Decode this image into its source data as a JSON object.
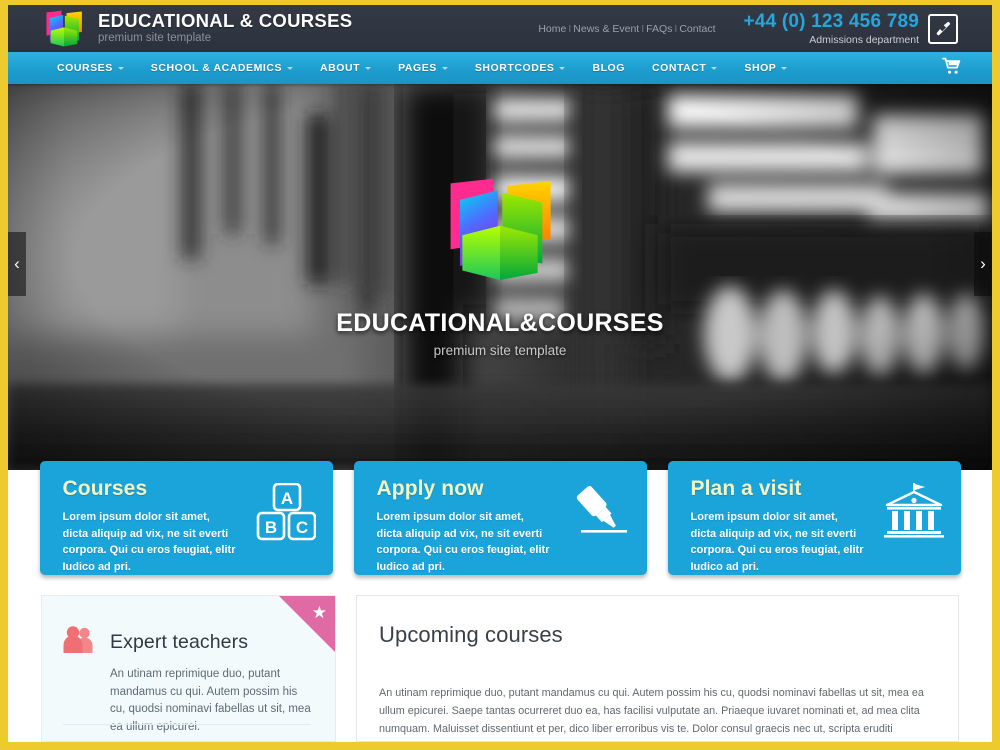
{
  "theme": {
    "frame_color": "#edcb2e",
    "accent_blue": "#1ba4da",
    "dark_bar": "#2e3440",
    "promo_heading": "#f2f5c3",
    "ribbon_pink": "#e06ba4",
    "teacher_icon": "#f0757a"
  },
  "header": {
    "brand_title": "EDUCATIONAL & COURSES",
    "brand_subtitle": "premium site template",
    "logo_icon": "open-book-logo-icon",
    "top_links": [
      "Home",
      "News & Event",
      "FAQs",
      "Contact"
    ],
    "separator": "I",
    "phone_number": "+44 (0) 123 456 789",
    "phone_label": "Admissions department",
    "phone_icon": "phone-handset-icon"
  },
  "nav": {
    "items": [
      {
        "label": "COURSES",
        "has_caret": true
      },
      {
        "label": "SCHOOL & ACADEMICS",
        "has_caret": true
      },
      {
        "label": "ABOUT",
        "has_caret": true
      },
      {
        "label": "PAGES",
        "has_caret": true
      },
      {
        "label": "SHORTCODES",
        "has_caret": true
      },
      {
        "label": "BLOG",
        "has_caret": false
      },
      {
        "label": "CONTACT",
        "has_caret": true
      },
      {
        "label": "SHOP",
        "has_caret": true
      }
    ],
    "cart_icon": "shopping-cart-icon"
  },
  "hero": {
    "logo_icon": "open-book-logo-icon",
    "title": "EDUCATIONAL&COURSES",
    "subtitle": "premium site template",
    "prev_icon": "chevron-left-icon",
    "prev_glyph": "‹",
    "next_icon": "chevron-right-icon",
    "next_glyph": "›",
    "background_description": "blurred grayscale school hallway"
  },
  "promos": [
    {
      "title": "Courses",
      "body": "Lorem ipsum dolor sit amet, dicta aliquip ad vix, ne sit everti corpora. Qui cu eros feugiat, elitr Iudico ad pri.",
      "icon": "abc-blocks-icon"
    },
    {
      "title": "Apply now",
      "body": "Lorem ipsum dolor sit amet, dicta aliquip ad vix, ne sit everti corpora. Qui cu eros feugiat, elitr Iudico ad pri.",
      "icon": "marker-pen-icon"
    },
    {
      "title": "Plan a visit",
      "body": "Lorem ipsum dolor sit amet, dicta aliquip ad vix, ne sit everti corpora. Qui cu eros feugiat, elitr Iudico ad pri.",
      "icon": "classical-building-icon"
    }
  ],
  "teachers": {
    "title": "Expert teachers",
    "icon": "two-people-icon",
    "ribbon_icon": "star-icon",
    "body": "An utinam reprimique duo, putant mandamus cu qui. Autem possim his cu, quodsi nominavi fabellas ut sit, mea ea ullum epicurei."
  },
  "upcoming": {
    "title": "Upcoming courses",
    "body": "An utinam reprimique duo, putant mandamus cu qui. Autem possim his cu, quodsi nominavi fabellas ut sit, mea ea ullum epicurei. Saepe tantas ocurreret duo ea, has facilisi vulputate an. Priaeque iuvaret nominati et, ad mea clita numquam. Maluisset dissentiunt et per, dico liber erroribus vis te. Dolor consul graecis nec ut, scripta eruditi scriptorem et nam."
  }
}
